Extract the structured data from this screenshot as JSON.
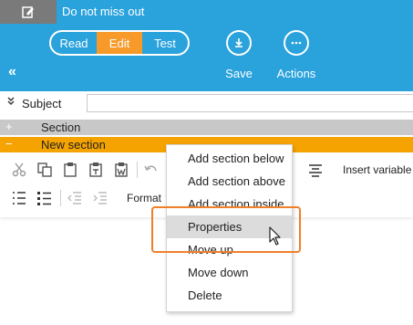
{
  "header": {
    "doc_title": "Do not miss out",
    "modes": [
      {
        "label": "Read",
        "active": false
      },
      {
        "label": "Edit",
        "active": true
      },
      {
        "label": "Test",
        "active": false
      }
    ],
    "collapse_symbol": "«",
    "save_label": "Save",
    "actions_label": "Actions",
    "accent_color": "#2aa2dc",
    "active_mode_color": "#f79a2a"
  },
  "subject": {
    "label": "Subject",
    "value": ""
  },
  "sections": [
    {
      "sign": "+",
      "label": "Section"
    },
    {
      "sign": "−",
      "label": "New section",
      "selected": true
    }
  ],
  "toolbar": {
    "format_label": "Format",
    "insert_variable_label": "Insert variable"
  },
  "context_menu": {
    "items": [
      {
        "label": "Add section below"
      },
      {
        "label": "Add section above"
      },
      {
        "label": "Add section inside"
      },
      {
        "label": "Properties",
        "hovered": true
      },
      {
        "label": "Move up"
      },
      {
        "label": "Move down"
      },
      {
        "label": "Delete"
      }
    ]
  }
}
